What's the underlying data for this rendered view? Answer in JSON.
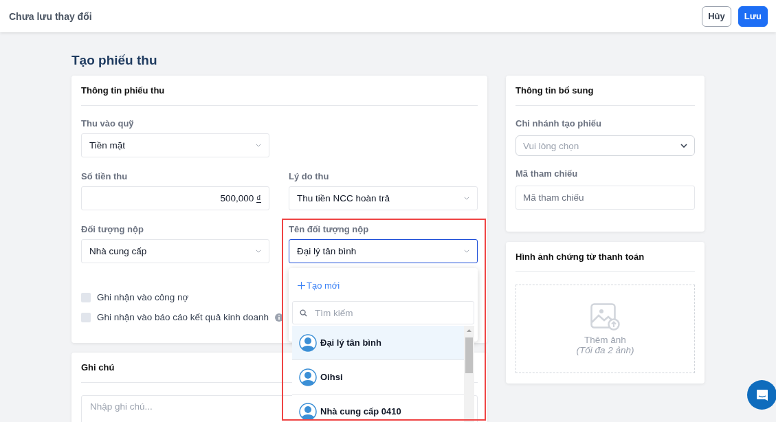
{
  "header": {
    "title": "Chưa lưu thay đổi",
    "buttons": [
      {
        "label": "Hủy",
        "kind": "secondary"
      },
      {
        "label": "Lưu",
        "kind": "primary"
      }
    ]
  },
  "page_title": "Tạo phiếu thu",
  "receipt_card": {
    "title": "Thông tin phiếu thu",
    "rows": [
      [
        {
          "label": "Thu vào quỹ",
          "kind": "select",
          "value": "Tiền mặt",
          "open": false
        }
      ],
      [
        {
          "label": "Số tiền thu",
          "kind": "amount",
          "value": "500,000",
          "currency": "₫",
          "open": false
        },
        {
          "label": "Lý do thu",
          "kind": "select",
          "value": "Thu tiền NCC hoàn trả",
          "open": false
        }
      ],
      [
        {
          "label": "Đối tượng nộp",
          "kind": "select",
          "value": "Nhà cung cấp",
          "open": false
        },
        {
          "label": "Tên đối tượng nộp",
          "kind": "select",
          "value": "Đại lý tân bình",
          "open": true
        }
      ]
    ],
    "checkboxes": [
      {
        "label": "Ghi nhận vào công nợ",
        "checked": false,
        "info": false
      },
      {
        "label": "Ghi nhận vào báo cáo kết quả kinh doanh",
        "checked": false,
        "info": true
      }
    ]
  },
  "dropdown": {
    "create_label": "Tạo mới",
    "search_placeholder": "Tìm kiếm",
    "options": [
      {
        "label": "Đại lý tân bình",
        "selected": true
      },
      {
        "label": "Oihsi",
        "selected": false
      },
      {
        "label": "Nhà cung cấp 0410",
        "selected": false
      }
    ]
  },
  "notes_card": {
    "title": "Ghi chú",
    "placeholder": "Nhập ghi chú..."
  },
  "extra_card": {
    "title": "Thông tin bổ sung",
    "fields": [
      {
        "label": "Chi nhánh tạo phiếu",
        "kind": "select",
        "placeholder": "Vui lòng chọn"
      },
      {
        "label": "Mã tham chiếu",
        "kind": "input",
        "placeholder": "Mã tham chiếu"
      }
    ]
  },
  "images_card": {
    "title": "Hình ảnh chứng từ thanh toán",
    "add_label": "Thêm ảnh",
    "limit_note": "(Tối đa 2 ảnh)"
  }
}
